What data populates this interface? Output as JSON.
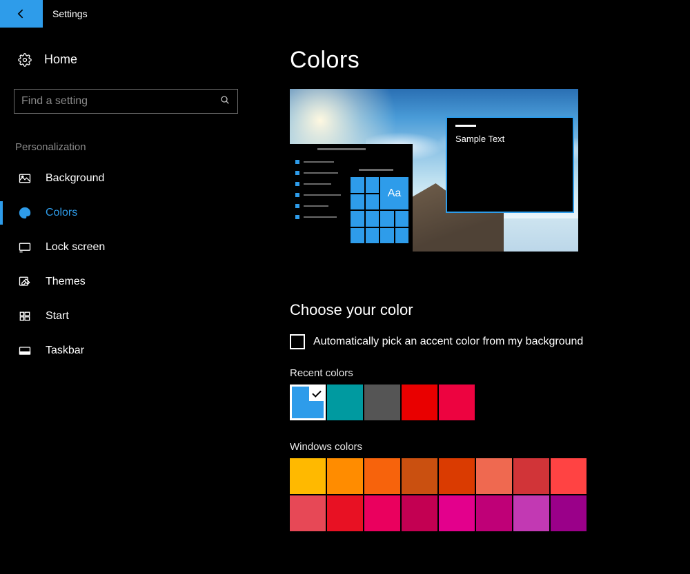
{
  "titlebar": {
    "title": "Settings"
  },
  "sidebar": {
    "home_label": "Home",
    "search_placeholder": "Find a setting",
    "section_title": "Personalization",
    "items": [
      {
        "id": "background",
        "label": "Background",
        "icon": "picture-icon",
        "active": false
      },
      {
        "id": "colors",
        "label": "Colors",
        "icon": "palette-icon",
        "active": true
      },
      {
        "id": "lock-screen",
        "label": "Lock screen",
        "icon": "monitor-icon",
        "active": false
      },
      {
        "id": "themes",
        "label": "Themes",
        "icon": "pencil-icon",
        "active": false
      },
      {
        "id": "start",
        "label": "Start",
        "icon": "start-icon",
        "active": false
      },
      {
        "id": "taskbar",
        "label": "Taskbar",
        "icon": "taskbar-icon",
        "active": false
      }
    ]
  },
  "content": {
    "page_title": "Colors",
    "preview": {
      "tile_text": "Aa",
      "window_text": "Sample Text"
    },
    "choose_heading": "Choose your color",
    "auto_accent_label": "Automatically pick an accent color from my background",
    "auto_accent_checked": false,
    "recent_title": "Recent colors",
    "recent_colors": [
      {
        "hex": "#2e9cea",
        "selected": true
      },
      {
        "hex": "#009aa0",
        "selected": false
      },
      {
        "hex": "#555555",
        "selected": false
      },
      {
        "hex": "#e90000",
        "selected": false
      },
      {
        "hex": "#ed0340",
        "selected": false
      }
    ],
    "windows_colors_title": "Windows colors",
    "windows_colors": [
      "#ffb900",
      "#ff8c00",
      "#f7630c",
      "#ca5010",
      "#da3b01",
      "#ef6950",
      "#d13438",
      "#ff4343",
      "#e74856",
      "#e81123",
      "#ea005e",
      "#c30052",
      "#e3008c",
      "#bf0077",
      "#c239b3",
      "#9a0089"
    ]
  }
}
